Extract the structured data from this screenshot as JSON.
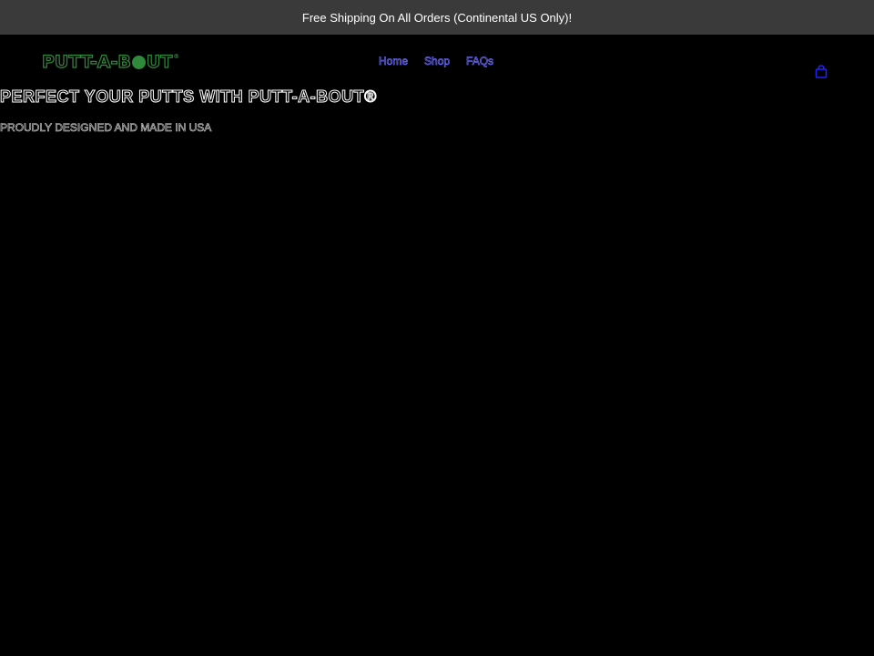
{
  "announcement": {
    "text": "Free Shipping On All Orders (Continental US Only)!"
  },
  "header": {
    "logo": {
      "part1": "PUTT-A-B",
      "part2": "UT",
      "trademark": "®"
    },
    "nav": [
      {
        "label": "Home"
      },
      {
        "label": "Shop"
      },
      {
        "label": "FAQs"
      }
    ],
    "cart_icon": "shopping-bag-icon"
  },
  "hero": {
    "title": "PERFECT YOUR PUTTS WITH PUTT-A-BOUT®",
    "subtitle": "PROUDLY DESIGNED AND MADE IN USA"
  },
  "colors": {
    "announcement_bg": "#3a3a3a",
    "background": "#000000",
    "logo_green": "#2f8a3c",
    "nav_link": "#6b6bff",
    "cart_blue": "#2222ee"
  }
}
